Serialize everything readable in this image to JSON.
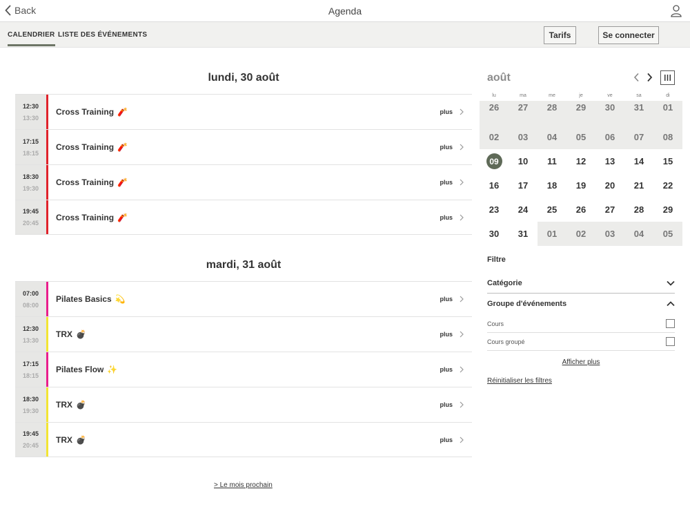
{
  "header": {
    "back_label": "Back",
    "title": "Agenda"
  },
  "tabs": [
    {
      "label": "CALENDRIER",
      "active": true
    },
    {
      "label": "LISTE DES ÉVÉNEMENTS",
      "active": false
    }
  ],
  "buttons": {
    "tarifs": "Tarifs",
    "login": "Se connecter"
  },
  "days": [
    {
      "title": "lundi, 30 août",
      "events": [
        {
          "start": "12:30",
          "end": "13:30",
          "name": "Cross Training",
          "emoji": "🧨",
          "color": "#e0222b",
          "more": "plus"
        },
        {
          "start": "17:15",
          "end": "18:15",
          "name": "Cross Training",
          "emoji": "🧨",
          "color": "#e0222b",
          "more": "plus"
        },
        {
          "start": "18:30",
          "end": "19:30",
          "name": "Cross Training",
          "emoji": "🧨",
          "color": "#e0222b",
          "more": "plus"
        },
        {
          "start": "19:45",
          "end": "20:45",
          "name": "Cross Training",
          "emoji": "🧨",
          "color": "#e0222b",
          "more": "plus"
        }
      ]
    },
    {
      "title": "mardi, 31 août",
      "events": [
        {
          "start": "07:00",
          "end": "08:00",
          "name": "Pilates Basics",
          "emoji": "💫",
          "color": "#e91e8c",
          "more": "plus"
        },
        {
          "start": "12:30",
          "end": "13:30",
          "name": "TRX",
          "emoji": "💣",
          "color": "#f2e534",
          "more": "plus"
        },
        {
          "start": "17:15",
          "end": "18:15",
          "name": "Pilates Flow",
          "emoji": "✨",
          "color": "#e91e8c",
          "more": "plus"
        },
        {
          "start": "18:30",
          "end": "19:30",
          "name": "TRX",
          "emoji": "💣",
          "color": "#f2e534",
          "more": "plus"
        },
        {
          "start": "19:45",
          "end": "20:45",
          "name": "TRX",
          "emoji": "💣",
          "color": "#f2e534",
          "more": "plus"
        }
      ]
    }
  ],
  "next_month": "> Le mois prochain",
  "calendar": {
    "month": "août",
    "weekdays": [
      "lu",
      "ma",
      "me",
      "je",
      "ve",
      "sa",
      "di"
    ],
    "weeks": [
      [
        {
          "d": "26",
          "out": true
        },
        {
          "d": "27",
          "out": true
        },
        {
          "d": "28",
          "out": true
        },
        {
          "d": "29",
          "out": true
        },
        {
          "d": "30",
          "out": true
        },
        {
          "d": "31",
          "out": true
        },
        {
          "d": "01",
          "out": true
        }
      ],
      [
        {
          "d": "02",
          "out": true
        },
        {
          "d": "03",
          "out": true
        },
        {
          "d": "04",
          "out": true
        },
        {
          "d": "05",
          "out": true
        },
        {
          "d": "06",
          "out": true
        },
        {
          "d": "07",
          "out": true
        },
        {
          "d": "08",
          "out": true
        }
      ],
      [
        {
          "d": "09",
          "sel": true
        },
        {
          "d": "10"
        },
        {
          "d": "11"
        },
        {
          "d": "12"
        },
        {
          "d": "13"
        },
        {
          "d": "14"
        },
        {
          "d": "15"
        }
      ],
      [
        {
          "d": "16"
        },
        {
          "d": "17"
        },
        {
          "d": "18"
        },
        {
          "d": "19"
        },
        {
          "d": "20"
        },
        {
          "d": "21"
        },
        {
          "d": "22"
        }
      ],
      [
        {
          "d": "23"
        },
        {
          "d": "24"
        },
        {
          "d": "25"
        },
        {
          "d": "26"
        },
        {
          "d": "27"
        },
        {
          "d": "28"
        },
        {
          "d": "29"
        }
      ],
      [
        {
          "d": "30"
        },
        {
          "d": "31"
        },
        {
          "d": "01",
          "out": true
        },
        {
          "d": "02",
          "out": true
        },
        {
          "d": "03",
          "out": true
        },
        {
          "d": "04",
          "out": true
        },
        {
          "d": "05",
          "out": true
        }
      ]
    ]
  },
  "filters": {
    "title": "Filtre",
    "category": "Catégorie",
    "group": "Groupe d'événements",
    "options": [
      {
        "label": "Cours",
        "checked": false
      },
      {
        "label": "Cours groupé",
        "checked": false
      }
    ],
    "show_more": "Afficher plus",
    "reset": "Réinitialiser les filtres"
  }
}
